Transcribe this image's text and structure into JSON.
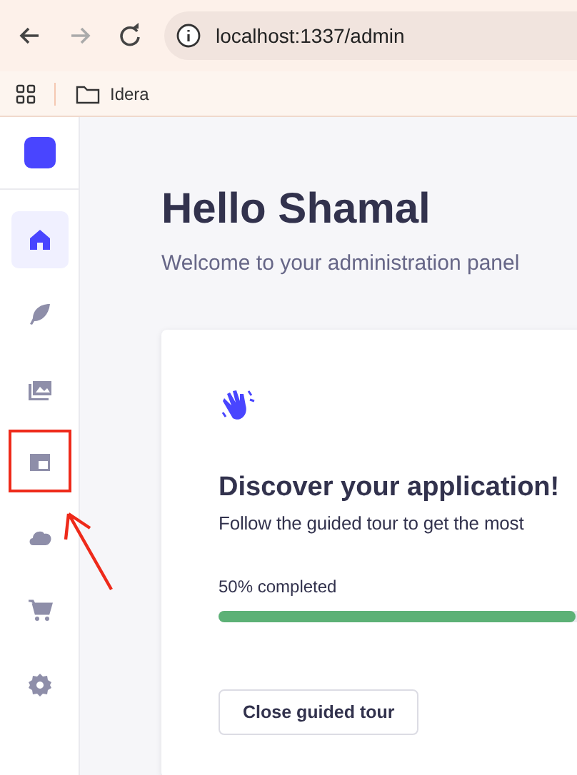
{
  "browser": {
    "url": "localhost:1337/admin",
    "bookmarks": [
      {
        "label": "Idera"
      }
    ]
  },
  "sidebar": {
    "items": [
      {
        "kind": "home",
        "selected": true
      },
      {
        "kind": "feather",
        "selected": false
      },
      {
        "kind": "media",
        "selected": false
      },
      {
        "kind": "layout",
        "selected": false,
        "highlighted": true
      },
      {
        "kind": "cloud",
        "selected": false
      },
      {
        "kind": "cart",
        "selected": false
      },
      {
        "kind": "settings",
        "selected": false
      }
    ]
  },
  "main": {
    "title": "Hello Shamal",
    "subtitle": "Welcome to your administration panel"
  },
  "card": {
    "title": "Discover your application!",
    "text": "Follow the guided tour to get the most",
    "progress_label": "50% completed",
    "level": 0.5,
    "button": "Close guided tour"
  }
}
